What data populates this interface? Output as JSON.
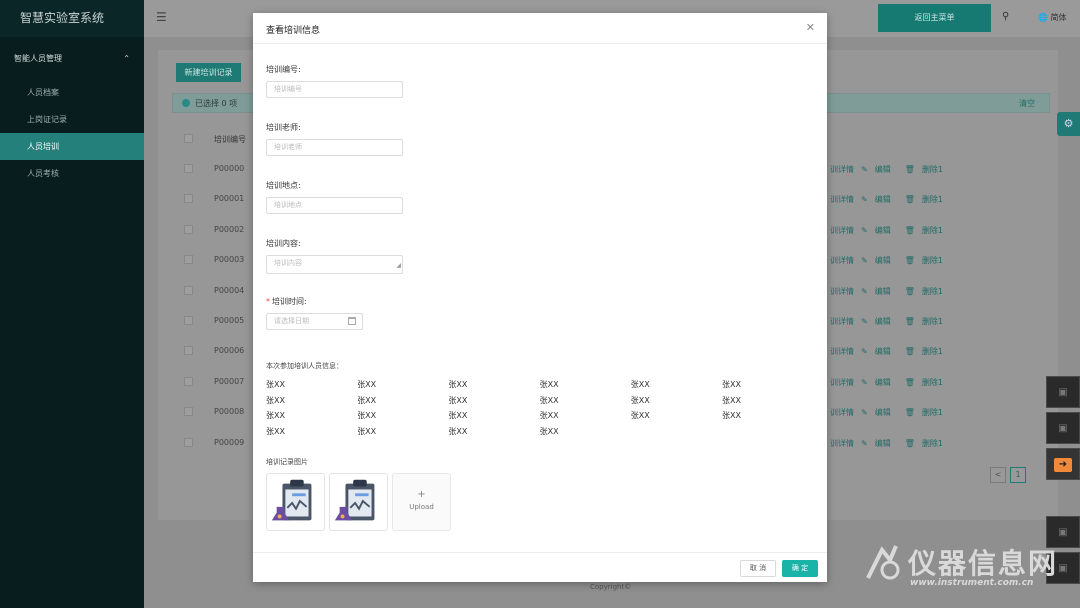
{
  "app": {
    "title": "智慧实验室系统"
  },
  "sidebar": {
    "group": "智能人员管理",
    "items": [
      {
        "label": "人员档案"
      },
      {
        "label": "上岗证记录"
      },
      {
        "label": "人员培训"
      },
      {
        "label": "人员考核"
      }
    ]
  },
  "topbar": {
    "back_label": "返回主菜单",
    "lang_label": "简体"
  },
  "content": {
    "new_button": "新建培训记录",
    "selection": {
      "text": "已选择 0 项",
      "clear": "清空"
    },
    "table_header": {
      "id": "培训编号"
    },
    "rows": [
      {
        "id": "P00000"
      },
      {
        "id": "P00001"
      },
      {
        "id": "P00002"
      },
      {
        "id": "P00003"
      },
      {
        "id": "P00004"
      },
      {
        "id": "P00005"
      },
      {
        "id": "P00006"
      },
      {
        "id": "P00007"
      },
      {
        "id": "P00008"
      },
      {
        "id": "P00009"
      }
    ],
    "row_actions": {
      "detail": "训详情",
      "edit": "编辑",
      "delete": "删除1"
    },
    "pagination": {
      "prev": "<",
      "current": "1"
    },
    "copyright": "Copyright©"
  },
  "modal": {
    "title": "查看培训信息",
    "fields": {
      "id_label": "培训编号:",
      "id_placeholder": "培训编号",
      "teacher_label": "培训老师:",
      "teacher_placeholder": "培训老师",
      "place_label": "培训地点:",
      "place_placeholder": "培训地点",
      "content_label": "培训内容:",
      "content_placeholder": "培训内容",
      "time_label": "培训时间:",
      "time_placeholder": "请选择日期"
    },
    "participants_title": "本次参加培训人员信息：",
    "participants": [
      "张XX",
      "张XX",
      "张XX",
      "张XX",
      "张XX",
      "张XX",
      "张XX",
      "张XX",
      "张XX",
      "张XX",
      "张XX",
      "张XX",
      "张XX",
      "张XX",
      "张XX",
      "张XX",
      "张XX",
      "张XX",
      "张XX",
      "张XX",
      "张XX",
      "张XX"
    ],
    "images_label": "培训记录图片",
    "upload_label": "Upload",
    "cancel_label": "取 消",
    "ok_label": "确 定"
  },
  "watermark": {
    "big": "仪器信息网",
    "small": "www.instrument.com.cn"
  },
  "colors": {
    "accent": "#1ab3a8",
    "sidebar_bg": "#081e1e",
    "active_item": "#23807a"
  }
}
